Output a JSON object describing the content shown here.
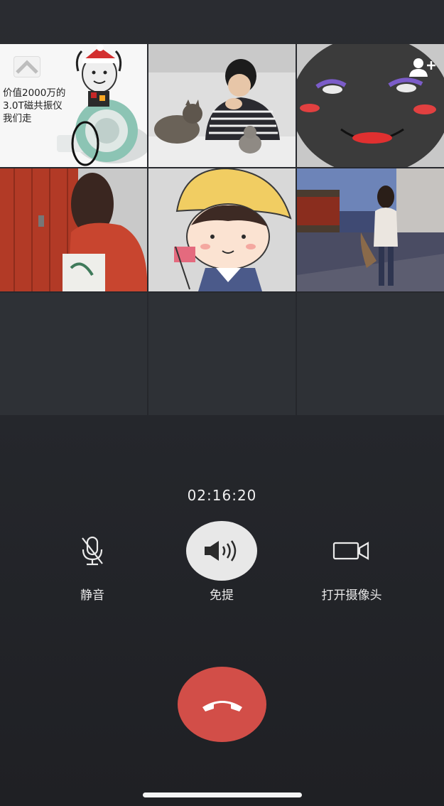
{
  "call": {
    "timer": "02:16:20"
  },
  "grid": {
    "meme_text": "价值2000万的\n3.0T磁共振仪\n我们走"
  },
  "controls": {
    "mute_label": "静音",
    "speaker_label": "免提",
    "camera_label": "打开摄像头",
    "speaker_active": true
  },
  "icons": {
    "collapse": "chevron-up-icon",
    "add_member": "add-user-icon",
    "mute": "microphone-muted-icon",
    "speaker": "speaker-icon",
    "camera": "video-camera-icon",
    "hangup": "phone-hangup-icon"
  },
  "colors": {
    "hangup": "#d24e48",
    "speaker_active_bg": "#e8e8e8",
    "background": "#26282d"
  }
}
